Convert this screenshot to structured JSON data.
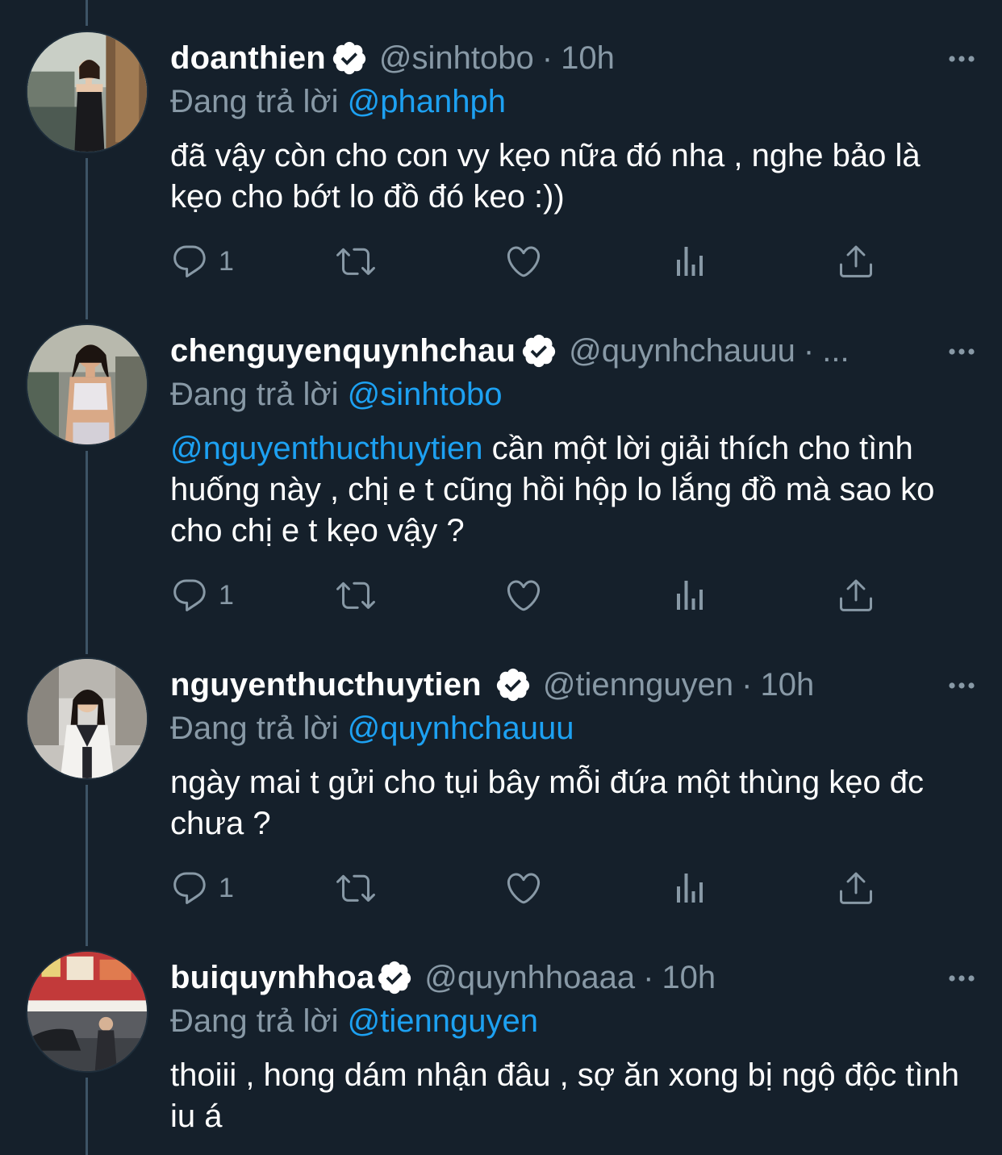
{
  "tweets": [
    {
      "name": "doanthien",
      "handle": "@sinhtobo",
      "dot": "·",
      "time": "10h",
      "reply_label": "Đang trả lời",
      "reply_to": "@phanhph",
      "body_mention": "",
      "body": "đã vậy còn cho con vy kẹo nữa đó nha , nghe bảo là kẹo cho bớt lo đồ đó keo :))",
      "reply_count": "1",
      "avatar": "photo-woman-black-dress"
    },
    {
      "name": "chenguyenquynhchau",
      "handle": "@quynhchauuu",
      "dot": "·",
      "time": "...",
      "reply_label": "Đang trả lời",
      "reply_to": "@sinhtobo",
      "body_mention": "@nguyenthucthuytien",
      "body": " cần một lời giải thích cho tình huống này , chị e t cũng hồi hộp lo lắng đồ mà sao ko cho chị e t kẹo vậy ?",
      "reply_count": "1",
      "avatar": "photo-woman-white-top"
    },
    {
      "name": "nguyenthucthuytien",
      "handle": "@tiennguyen",
      "dot": "·",
      "time": "10h",
      "reply_label": "Đang trả lời",
      "reply_to": "@quynhchauuu",
      "body_mention": "",
      "body": "ngày mai t gửi cho tụi bây mỗi đứa một thùng kẹo đc chưa ?",
      "reply_count": "1",
      "avatar": "photo-woman-sweater-vest"
    },
    {
      "name": "buiquynhhoa",
      "handle": "@quynhhoaaa",
      "dot": "·",
      "time": "10h",
      "reply_label": "Đang trả lời",
      "reply_to": "@tiennguyen",
      "body_mention": "",
      "body": "thoiii , hong dám nhận đâu , sợ ăn xong bị ngộ độc tình iu á",
      "reply_count": "",
      "avatar": "photo-street-ramen-shop"
    }
  ],
  "icons": {
    "verified": "verified-badge-icon",
    "more": "more-dots-icon",
    "reply": "reply-bubble-icon",
    "retweet": "retweet-icon",
    "like": "heart-icon",
    "analytics": "analytics-bars-icon",
    "share": "share-upload-icon"
  },
  "colors": {
    "background": "#15202b",
    "secondary_text": "#8899a6",
    "link": "#1da1f2",
    "thread_line": "#3d5466"
  }
}
